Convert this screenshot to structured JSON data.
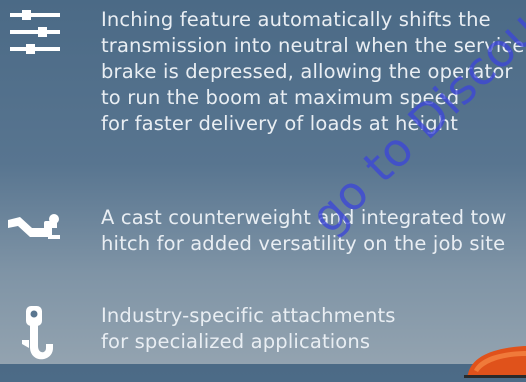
{
  "features": [
    {
      "icon": "sliders-icon",
      "lines": [
        "Inching feature automatically shifts the",
        "transmission into neutral when the service",
        "brake is depressed, allowing the operator",
        "to run the boom at maximum speed",
        "for faster delivery of loads at height"
      ]
    },
    {
      "icon": "tow-hitch-icon",
      "lines": [
        "A cast counterweight and integrated tow",
        "hitch for added versatility on the job site"
      ]
    },
    {
      "icon": "crane-hook-icon",
      "lines": [
        "Industry-specific attachments",
        "for specialized applications"
      ]
    }
  ],
  "watermark": "go to Discount-",
  "colors": {
    "text": "#e9eef3",
    "icon": "#ffffff",
    "watermark": "#3c46d7",
    "machine_accent": "#e0521b"
  }
}
